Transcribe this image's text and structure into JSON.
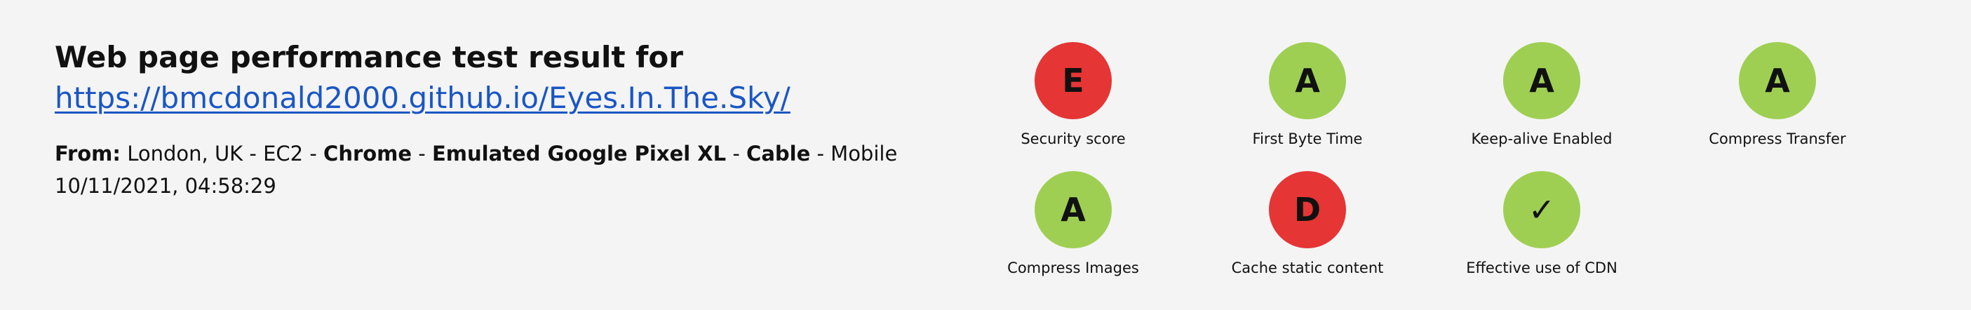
{
  "header": {
    "title": "Web page performance test result for",
    "url": "https://bmcdonald2000.github.io/Eyes.In.The.Sky/"
  },
  "meta": {
    "from_label": "From:",
    "location": " London, UK - EC2 - ",
    "browser": "Chrome",
    "sep1": " - ",
    "device": "Emulated Google Pixel XL",
    "sep2": " - ",
    "connection": "Cable",
    "platform": " - Mobile",
    "timestamp": "10/11/2021, 04:58:29"
  },
  "colors": {
    "bad": "#e53535",
    "good": "#9ecf53",
    "link": "#1a56c4",
    "background": "#f4f4f4"
  },
  "grades": [
    {
      "grade": "E",
      "label": "Security score",
      "status": "bad"
    },
    {
      "grade": "A",
      "label": "First Byte Time",
      "status": "good"
    },
    {
      "grade": "A",
      "label": "Keep-alive Enabled",
      "status": "good"
    },
    {
      "grade": "A",
      "label": "Compress Transfer",
      "status": "good"
    },
    {
      "grade": "A",
      "label": "Compress Images",
      "status": "good"
    },
    {
      "grade": "D",
      "label": "Cache static content",
      "status": "bad"
    },
    {
      "grade": "✓",
      "label": "Effective use of CDN",
      "status": "good",
      "icon": "checkmark-icon"
    }
  ]
}
